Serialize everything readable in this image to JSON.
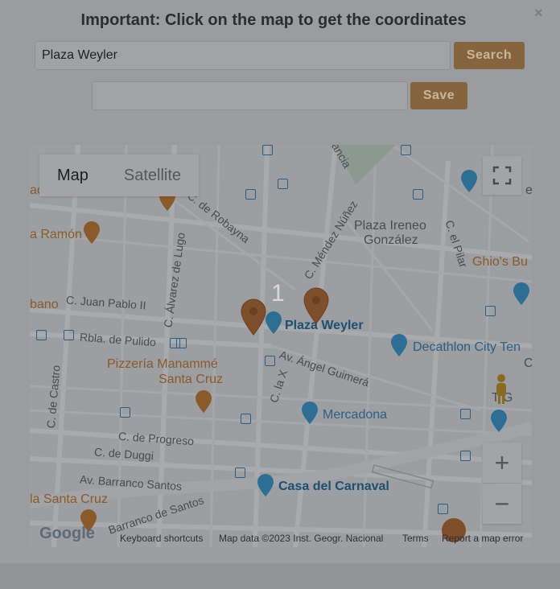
{
  "dialog": {
    "title": "Important: Click on the map to get the coordinates",
    "close_glyph": "×"
  },
  "search": {
    "value": "Plaza Weyler",
    "button_label": "Search"
  },
  "save": {
    "value": "",
    "button_label": "Save"
  },
  "map": {
    "map_types": [
      "Map",
      "Satellite"
    ],
    "marker_label": "1",
    "zoom_in": "+",
    "zoom_out": "−",
    "logo": "Google",
    "attribution": {
      "shortcuts": "Keyboard shortcuts",
      "data": "Map data ©2023 Inst. Geogr. Nacional",
      "terms": "Terms",
      "report": "Report a map error"
    },
    "labels": {
      "plaza_weyler": "Plaza Weyler",
      "plaza_ireneo_1": "Plaza Ireneo",
      "plaza_ireneo_2": "González",
      "decathlon": "Decathlon City Ten",
      "pizzeria_1": "Pizzería Manammé",
      "pizzeria_2": "Santa Cruz",
      "mercadona": "Mercadona",
      "casa_carnaval": "Casa del Carnaval",
      "ghios": "Ghio's Bu",
      "ramon": "a Ramón",
      "santa_cruz": "la Santa Cruz",
      "bano": "bano",
      "ad": "ad",
      "right_e": "e",
      "right_c": "C",
      "right_tg": "T G",
      "c_robayna": "C. de Robayna",
      "c_mendez": "C. Méndez Núñez",
      "c_pilar": "C. el Pilar",
      "c_juan_pablo": "C. Juan Pablo II",
      "c_alvarez": "C. Álvarez de Lugo",
      "rbla_pulido": "Rbla. de Pulido",
      "av_guimera": "Av. Ángel Guimerá",
      "c_la_x": "C. la X",
      "c_castro": "C. de Castro",
      "c_progreso": "C. de Progreso",
      "c_duggi": "C. de Duggi",
      "av_barranco": "Av. Barranco Santos",
      "barranco_santos": "Barranco de Santos",
      "mancia": "mancia"
    }
  }
}
